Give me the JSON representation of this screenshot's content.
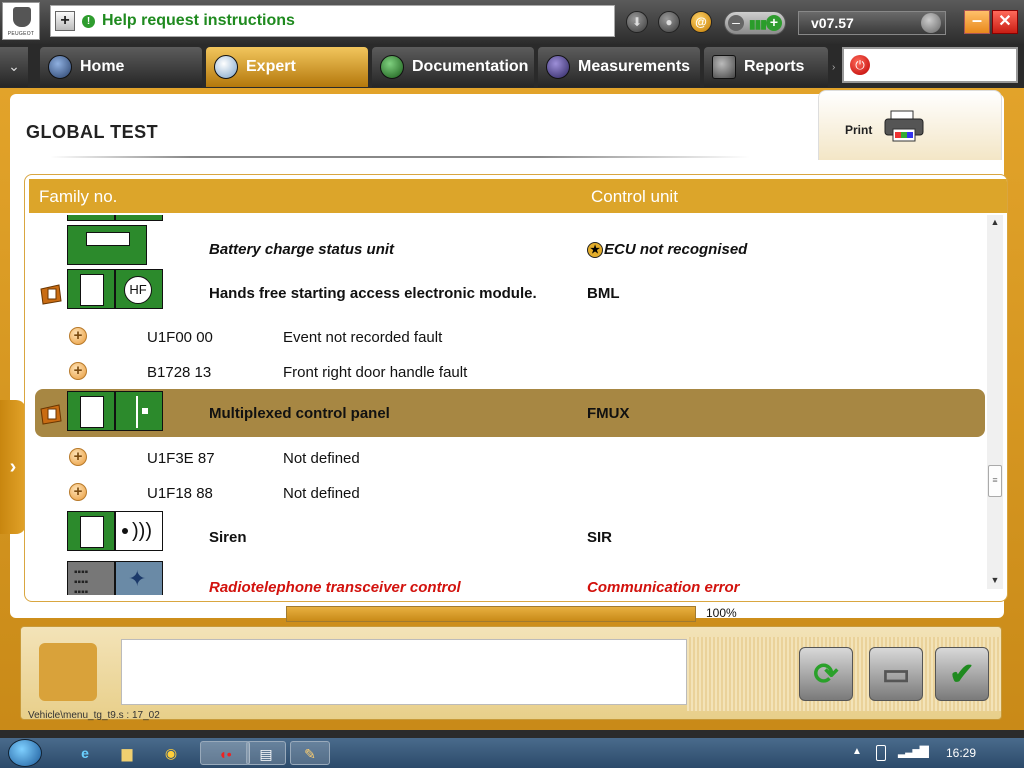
{
  "app": {
    "help_text": "Help request instructions",
    "version": "v07.57",
    "logo_text": "PEUGEOT"
  },
  "nav": {
    "tabs": [
      {
        "label": "Home",
        "active": false
      },
      {
        "label": "Expert",
        "active": true
      },
      {
        "label": "Documentation",
        "active": false
      },
      {
        "label": "Measurements",
        "active": false
      },
      {
        "label": "Reports",
        "active": false
      }
    ]
  },
  "page": {
    "title": "GLOBAL TEST",
    "print_label": "Print"
  },
  "table": {
    "headers": {
      "family": "Family no.",
      "unit": "Control unit"
    },
    "rows": [
      {
        "kind": "ecu",
        "name": "Battery charge status unit",
        "unit": "ECU not recognised",
        "style": "italic",
        "unit_star": true
      },
      {
        "kind": "ecu",
        "name": "Hands free starting access electronic module.",
        "unit": "BML",
        "flag": true
      },
      {
        "kind": "fault",
        "code": "U1F00 00",
        "desc": "Event not recorded fault"
      },
      {
        "kind": "fault",
        "code": "B1728 13",
        "desc": "Front right door handle fault"
      },
      {
        "kind": "ecu",
        "name": "Multiplexed control panel",
        "unit": "FMUX",
        "flag": true,
        "selected": true
      },
      {
        "kind": "fault",
        "code": "U1F3E 87",
        "desc": "Not defined"
      },
      {
        "kind": "fault",
        "code": "U1F18 88",
        "desc": "Not defined"
      },
      {
        "kind": "ecu",
        "name": "Siren",
        "unit": "SIR"
      },
      {
        "kind": "ecu",
        "name": "Radiotelephone transceiver control",
        "unit": "Communication error",
        "style": "error"
      }
    ]
  },
  "progress": {
    "value": 100,
    "label": "100%"
  },
  "status_path": "Vehicle\\menu_tg_t9.s : 17_02",
  "taskbar": {
    "clock": "16:29"
  },
  "colors": {
    "accent": "#dca52a",
    "selected_row": "#a78743",
    "error": "#d2120d",
    "ok_green": "#1f8a1f"
  },
  "icons": [
    "help-plus-icon",
    "info-icon",
    "download-icon",
    "user-icon",
    "at-icon",
    "volume-minus-icon",
    "volume-plus-icon",
    "minimize-icon",
    "close-icon",
    "home-icon",
    "expert-magnifier-icon",
    "documentation-icon",
    "measurements-icon",
    "reports-icon",
    "power-icon",
    "printer-icon",
    "refresh-icon",
    "print-report-icon",
    "checkmark-icon",
    "windows-start-icon",
    "ie-icon",
    "explorer-icon",
    "chrome-icon",
    "notepad-icon",
    "paint-icon",
    "battery-icon",
    "wifi-icon"
  ]
}
